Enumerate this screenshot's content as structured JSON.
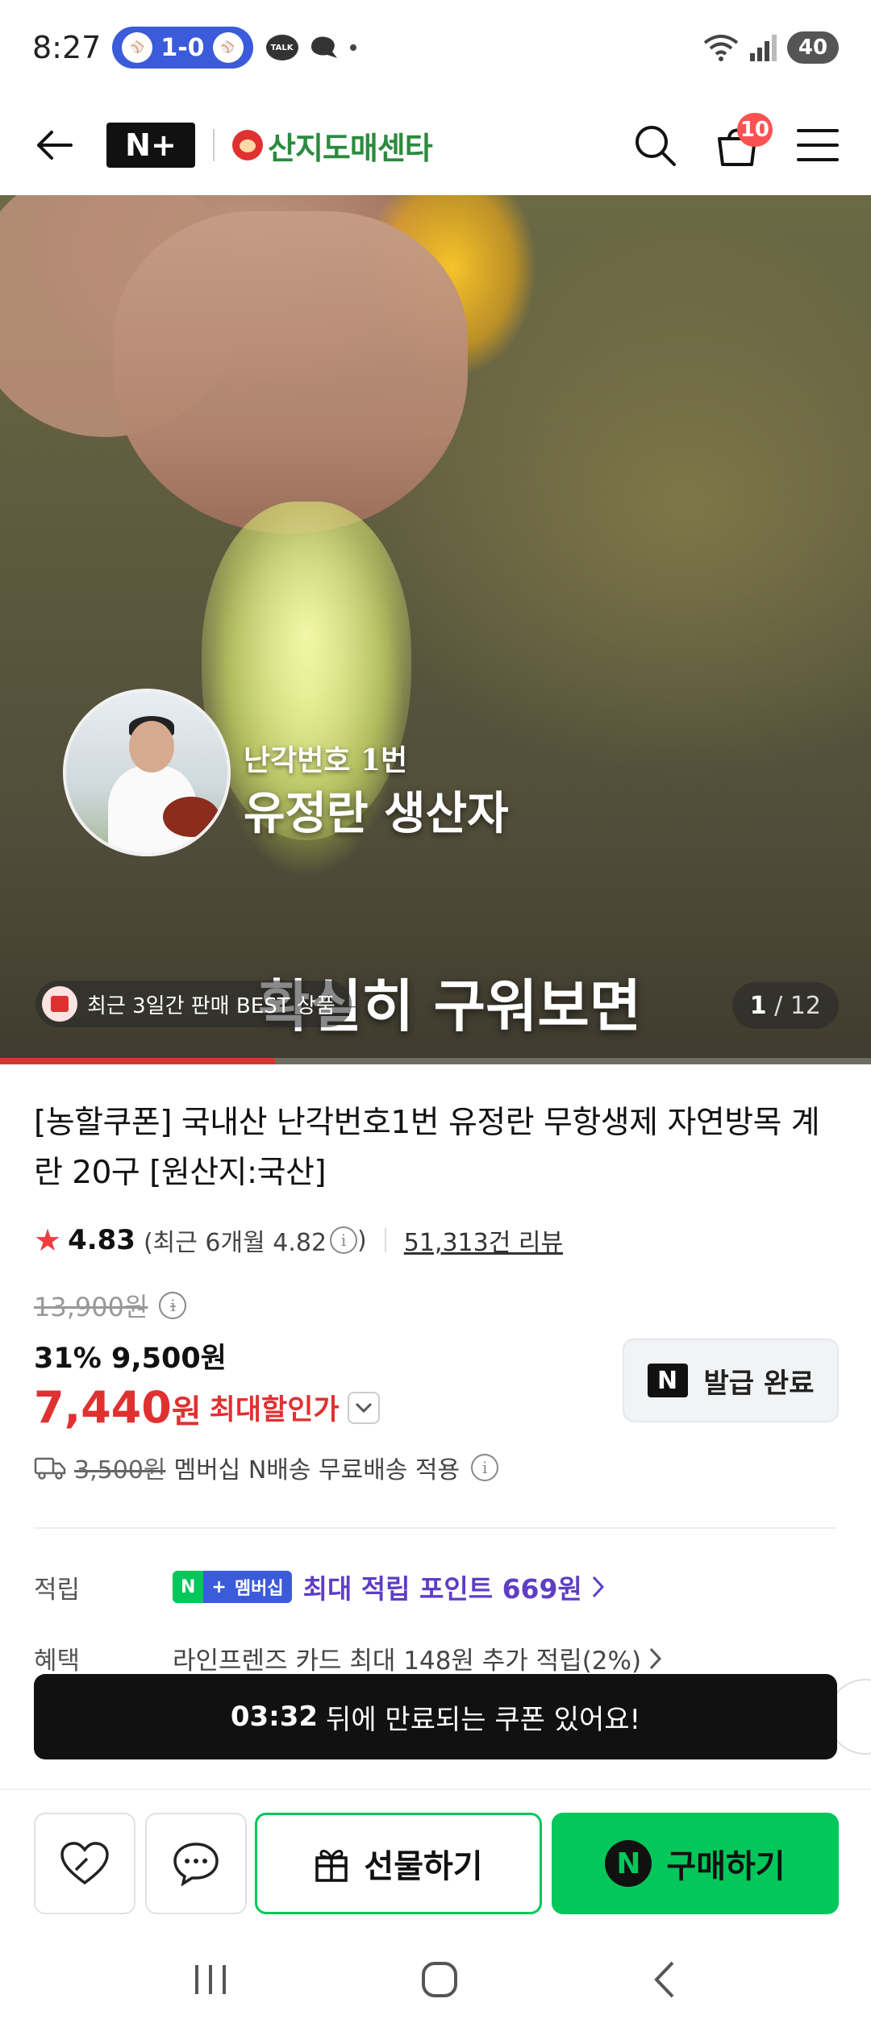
{
  "status_bar": {
    "time": "8:27",
    "score": "1-0",
    "talk_label": "TALK",
    "battery": "40"
  },
  "header": {
    "logo_text": "N+",
    "store_name": "산지도매센타",
    "cart_count": "10"
  },
  "hero": {
    "caption_small": "난각번호 1번",
    "caption_big": "유정란 생산자",
    "subtitle": "확실히 구워보면",
    "best_tag": "최근 3일간 판매 BEST 상품",
    "page_current": "1",
    "page_total": "12",
    "progress_fraction": 0.083
  },
  "product": {
    "title": "[농할쿠폰] 국내산 난각번호1번 유정란 무항생제 자연방목 계란 20구 [원산지:국산]",
    "rating": "4.83",
    "recent_rating": "(최근 6개월 4.82",
    "recent_rating_close": ")",
    "review_count": "51,313건 리뷰",
    "original_price": "13,900원",
    "sale_line": "31% 9,500원",
    "max_price_number": "7,440",
    "max_price_unit": "원",
    "max_price_label": "최대할인가",
    "coupon_button": "발급 완료",
    "shipping_fee": "3,500원",
    "shipping_text": "멤버십 N배송 무료배송 적용"
  },
  "benefits": {
    "points_label": "적립",
    "membership_badge_mark": "N",
    "membership_badge_plus": "+",
    "membership_badge_text": "멤버십",
    "points_text": "최대 적립 포인트 669원",
    "perk_label": "혜택",
    "perk_text": "라인프렌즈 카드 최대 148원 추가 적립(2%)"
  },
  "toast": {
    "time": "03:32",
    "message": "뒤에 만료되는 쿠폰 있어요!"
  },
  "actions": {
    "gift_label": "선물하기",
    "buy_label": "구매하기",
    "buy_mark": "N"
  },
  "colors": {
    "accent_green": "#03c75a",
    "sale_red": "#e03131",
    "points_purple": "#5f3dc4"
  }
}
